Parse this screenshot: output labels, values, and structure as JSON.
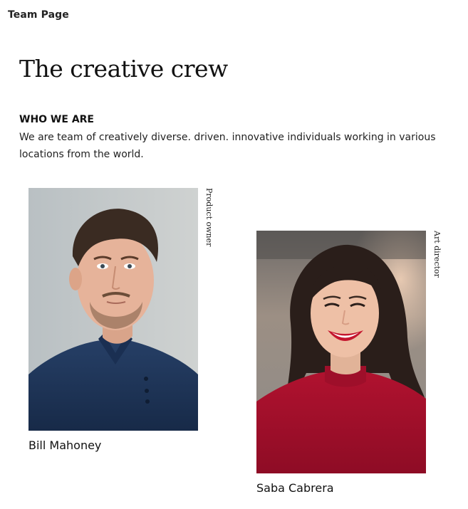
{
  "header": {
    "app_title": "Team Page"
  },
  "hero": {
    "title": "The creative crew"
  },
  "about": {
    "heading": "WHO WE ARE",
    "text": "We are team of creatively diverse. driven. innovative individuals working in various locations from the world."
  },
  "team": {
    "members": [
      {
        "name": "Bill Mahoney",
        "role": "Product owner"
      },
      {
        "name": "Saba Cabrera",
        "role": "Art director"
      }
    ]
  },
  "colors": {
    "background": "#ffffff",
    "text": "#111111",
    "bill_shirt": "#1f3559",
    "saba_sweater": "#a3102d"
  }
}
